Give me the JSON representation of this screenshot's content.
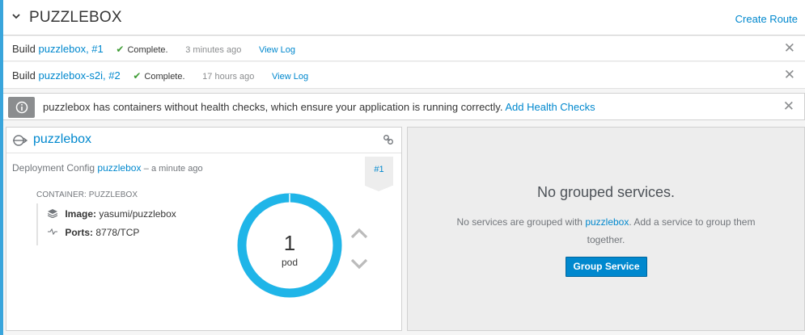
{
  "header": {
    "title": "PUZZLEBOX",
    "create_route": "Create Route"
  },
  "builds": [
    {
      "prefix": "Build",
      "name": "puzzlebox, #1",
      "status": "Complete.",
      "ago": "3 minutes ago",
      "view_log": "View Log"
    },
    {
      "prefix": "Build",
      "name": "puzzlebox-s2i, #2",
      "status": "Complete.",
      "ago": "17 hours ago",
      "view_log": "View Log"
    }
  ],
  "alert": {
    "message": "puzzlebox has containers without health checks, which ensure your application is running correctly.",
    "action": "Add Health Checks"
  },
  "deployment": {
    "name": "puzzlebox",
    "config_label": "Deployment Config",
    "config_name": "puzzlebox",
    "config_ago": "– a minute ago",
    "revision": "#1",
    "container_label": "CONTAINER: PUZZLEBOX",
    "image_key": "Image:",
    "image_value": "yasumi/puzzlebox",
    "ports_key": "Ports:",
    "ports_value": "8778/TCP",
    "pod_count": "1",
    "pod_label": "pod",
    "pods_running_fraction": 1.0
  },
  "services": {
    "heading": "No grouped services.",
    "text_before": "No services are grouped with",
    "text_link": "puzzlebox",
    "text_after": ". Add a service to group them together.",
    "button": "Group Service"
  },
  "colors": {
    "accent": "#39a5dc",
    "link": "#0088ce",
    "success": "#3f9c35",
    "donut": "#1fb5e8"
  },
  "icons": [
    "chevron-down-icon",
    "check-icon",
    "close-icon",
    "info-icon",
    "deployment-icon",
    "link-icon",
    "layers-icon",
    "ports-icon",
    "chevron-up-icon"
  ]
}
